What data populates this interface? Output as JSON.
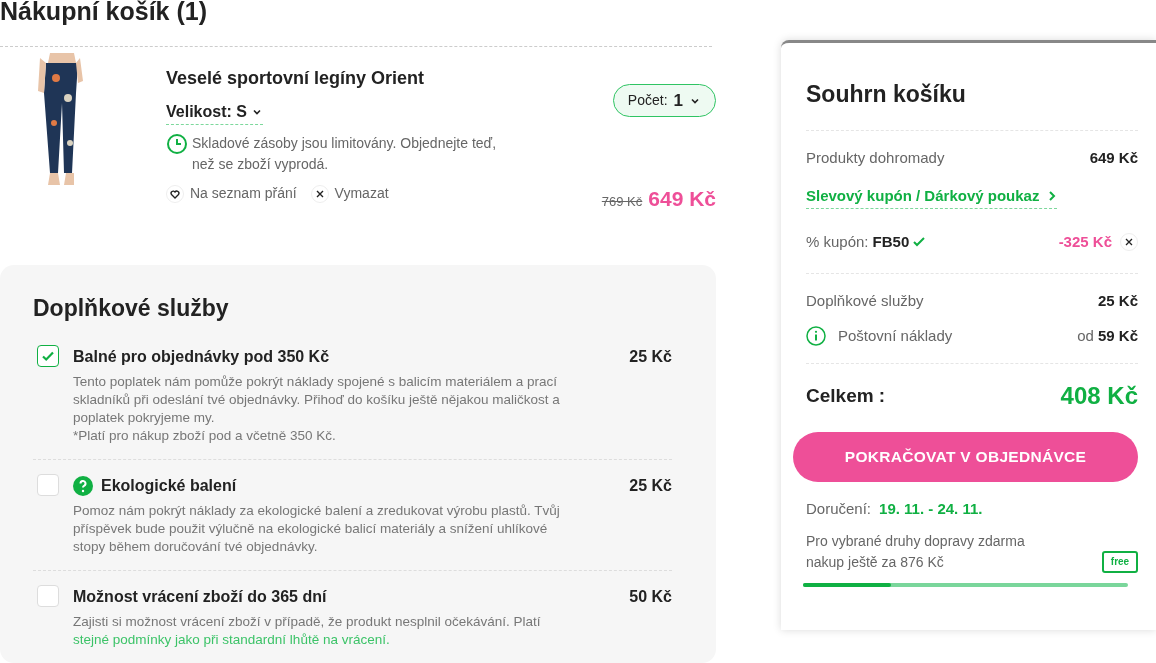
{
  "page_title": "Nákupní košík (1)",
  "cart_item": {
    "name": "Veselé sportovní legíny Orient",
    "size_label": "Velikost: S",
    "stock_note": "Skladové zásoby jsou limitovány. Objednejte teď, než se zboží vyprodá.",
    "wishlist": "Na seznam přání",
    "remove": "Vymazat",
    "quantity_label": "Počet:",
    "quantity": "1",
    "old_price": "769 Kč",
    "price": "649 Kč"
  },
  "extras": {
    "title": "Doplňkové služby",
    "items": [
      {
        "title": "Balné pro objednávky pod 350 Kč",
        "price": "25 Kč",
        "checked": true,
        "help": false,
        "text": "Tento poplatek nám pomůže pokrýt náklady spojené s balicím materiálem a prací skladníků při odeslání tvé objednávky. Přihoď do košíku ještě nějakou maličkost a poplatek pokryjeme my.",
        "note": "*Platí pro nákup zboží pod a včetně 350 Kč."
      },
      {
        "title": "Ekologické balení",
        "price": "25 Kč",
        "checked": false,
        "help": true,
        "text": "Pomoz nám pokrýt náklady za ekologické balení a zredukovat výrobu plastů. Tvůj příspěvek bude použit výlučně na ekologické balicí materiály a snížení uhlíkové stopy během doručování tvé objednávky."
      },
      {
        "title": "Možnost vrácení zboží do 365 dní",
        "price": "50 Kč",
        "checked": false,
        "help": false,
        "text": "Zajisti si možnost vrácení zboží v případě, že produkt nesplnil očekávání. Platí",
        "link": "stejné podmínky jako při standardní lhůtě na vrácení."
      }
    ]
  },
  "summary": {
    "title": "Souhrn košíku",
    "products_label": "Produkty dohromady",
    "products_value": "649 Kč",
    "coupon_link": "Slevový kupón / Dárkový poukaz",
    "coupon_label": "% kupón:",
    "coupon_code": "FB50",
    "coupon_value": "-325 Kč",
    "extras_label": "Doplňkové služby",
    "extras_value": "25 Kč",
    "shipping_label": "Poštovní náklady",
    "shipping_prefix": "od",
    "shipping_value": "59 Kč",
    "total_label": "Celkem :",
    "total_value": "408 Kč",
    "checkout": "POKRAČOVAT V OBJEDNÁVCE",
    "delivery_label": "Doručení:",
    "delivery_value": "19. 11. - 24. 11.",
    "free_shipping_note": "Pro vybrané druhy dopravy zdarma nakup ještě za 876 Kč",
    "free_badge": "free",
    "level": 0.27
  }
}
